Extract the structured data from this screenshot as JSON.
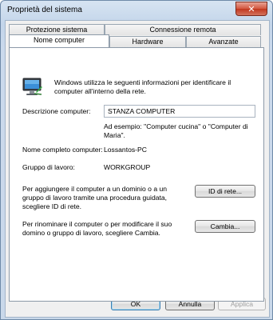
{
  "window": {
    "title": "Proprietà del sistema",
    "close_label": "✕"
  },
  "tabs": {
    "row_top": [
      {
        "label": "Protezione sistema"
      },
      {
        "label": "Connessione remota"
      }
    ],
    "row_bottom": [
      {
        "label": "Nome computer",
        "active": true
      },
      {
        "label": "Hardware"
      },
      {
        "label": "Avanzate"
      }
    ]
  },
  "panel": {
    "intro_text_line1": "Windows utilizza le seguenti informazioni per identificare il",
    "intro_text_line2": "computer all'interno della rete.",
    "description_label": "Descrizione computer:",
    "description_value": "STANZA COMPUTER",
    "example_line1": "Ad esempio: \"Computer cucina\" o \"Computer di",
    "example_line2": "Maria\".",
    "full_name_label": "Nome completo computer:",
    "full_name_value": "Lossantos-PC",
    "workgroup_label": "Gruppo di lavoro:",
    "workgroup_value": "WORKGROUP",
    "network_id_text_line1": "Per aggiungere il computer a un dominio o a un",
    "network_id_text_line2": "gruppo di lavoro tramite una procedura guidata,",
    "network_id_text_line3": "scegliere ID di rete.",
    "network_id_button": "ID di rete...",
    "rename_text_line1": "Per rinominare il computer o per modificare il suo",
    "rename_text_line2": "domino o gruppo di lavoro, scegliere Cambia.",
    "change_button": "Cambia..."
  },
  "footer": {
    "ok_button": "OK",
    "cancel_button": "Annulla",
    "apply_button": "Applica"
  },
  "colors": {
    "accent": "#3c7fb1",
    "window_frame": "#c3d5ea",
    "close_button": "#c1371e"
  },
  "icons": [
    "computer-monitor-icon",
    "close-icon"
  ]
}
